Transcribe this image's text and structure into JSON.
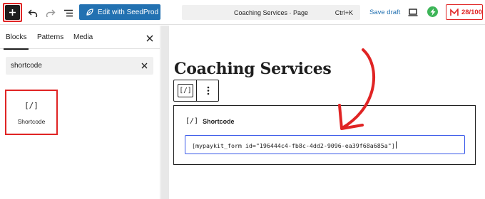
{
  "toolbar": {
    "seedprod_label": "Edit with SeedProd",
    "command_title": "Coaching Services · Page",
    "command_shortcut": "Ctrl+K",
    "save_draft_label": "Save draft",
    "seo_score": "28/100"
  },
  "sidebar": {
    "tabs": [
      {
        "label": "Blocks",
        "active": true
      },
      {
        "label": "Patterns",
        "active": false
      },
      {
        "label": "Media",
        "active": false
      }
    ],
    "search_value": "shortcode",
    "result": {
      "glyph": "[/]",
      "label": "Shortcode"
    }
  },
  "editor": {
    "page_title": "Coaching Services",
    "block_toolbar_glyph": "[/]",
    "shortcode_block": {
      "glyph": "[/]",
      "title": "Shortcode",
      "value": "[mypaykit_form id=\"196444c4-fb8c-4dd2-9096-ea39f68a685a\"]"
    }
  },
  "colors": {
    "annotation_red": "#e02424",
    "seedprod_blue": "#2271b1",
    "focus_blue": "#3858e9",
    "boost_green": "#3db558"
  },
  "icons": [
    "plus-icon",
    "undo-icon",
    "redo-icon",
    "document-outline-icon",
    "seedprod-leaf-icon",
    "desktop-preview-icon",
    "lightning-icon",
    "seo-score-icon",
    "close-icon",
    "more-options-icon"
  ]
}
